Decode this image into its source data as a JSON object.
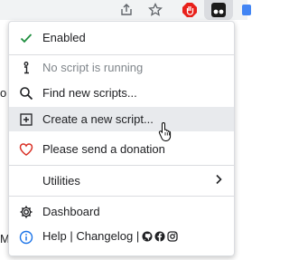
{
  "toolbar": {
    "icons": [
      "share-icon",
      "star-icon",
      "adblock-icon",
      "tampermonkey-icon",
      "extension-icon"
    ],
    "colors": {
      "adblock": "#e8201a",
      "tampermonkey": "#1a1a1a",
      "selected_bg": "#dadce0"
    }
  },
  "page_behind": {
    "fragments": [
      "o",
      "M"
    ]
  },
  "menu": {
    "items": [
      {
        "label": "Enabled",
        "icon": "check-icon"
      },
      {
        "label": "No script is running",
        "icon": "info-i-icon",
        "disabled": true
      },
      {
        "label": "Find new scripts...",
        "icon": "search-icon"
      },
      {
        "label": "Create a new script...",
        "icon": "plus-square-icon",
        "hovered": true
      },
      {
        "label": "Please send a donation",
        "icon": "heart-icon"
      },
      {
        "label": "Utilities",
        "icon": "chevron-right-icon",
        "submenu": true
      },
      {
        "label": "Dashboard",
        "icon": "gear-icon"
      },
      {
        "label": "Help | Changelog |",
        "icon": "info-circle-icon",
        "trailing_icons": [
          "github-icon",
          "facebook-icon",
          "instagram-icon"
        ]
      }
    ],
    "colors": {
      "check": "#1e8e3e",
      "heart": "#d93025",
      "info": "#1a73e8",
      "hover_bg": "#e8eaed"
    }
  }
}
